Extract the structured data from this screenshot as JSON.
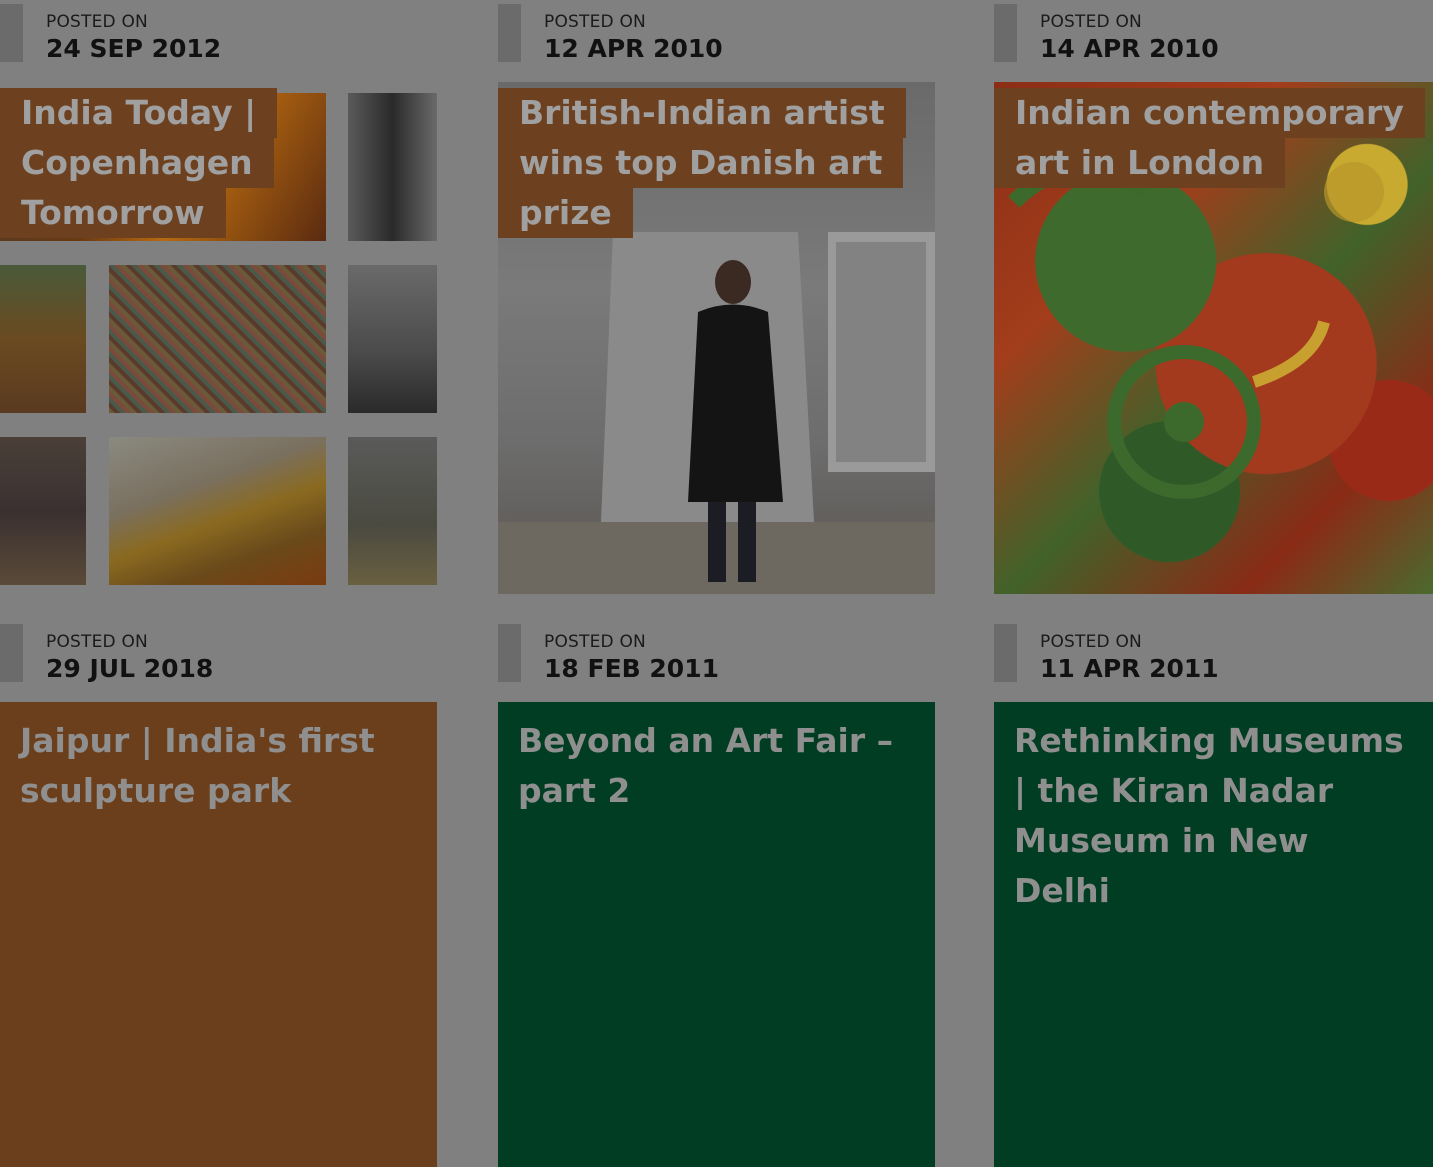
{
  "posts": [
    {
      "posted_label": "POSTED ON",
      "date": "24 SEP 2012",
      "title_lines": [
        "India Today |",
        "Copenhagen",
        "Tomorrow"
      ]
    },
    {
      "posted_label": "POSTED ON",
      "date": "12 APR 2010",
      "title_lines": [
        "British-Indian artist",
        "wins top Danish art",
        "prize"
      ]
    },
    {
      "posted_label": "POSTED ON",
      "date": "14 APR 2010",
      "title_lines": [
        "Indian contemporary",
        "art in London"
      ]
    },
    {
      "posted_label": "POSTED ON",
      "date": "29 JUL 2018",
      "title": "Jaipur | India's first sculpture park",
      "color": "#6b3f1b"
    },
    {
      "posted_label": "POSTED ON",
      "date": "18 FEB 2011",
      "title": "Beyond an Art Fair – part 2",
      "color": "#013d22"
    },
    {
      "posted_label": "POSTED ON",
      "date": "11 APR 2011",
      "title": "Rethinking Museums | the Kiran Nadar Museum in New Delhi",
      "color": "#013d22"
    }
  ],
  "colors": {
    "overlay_gray": "#808080",
    "chip_brown": "#6d4020",
    "brown_block": "#6b3f1b",
    "green_block": "#013d22"
  }
}
